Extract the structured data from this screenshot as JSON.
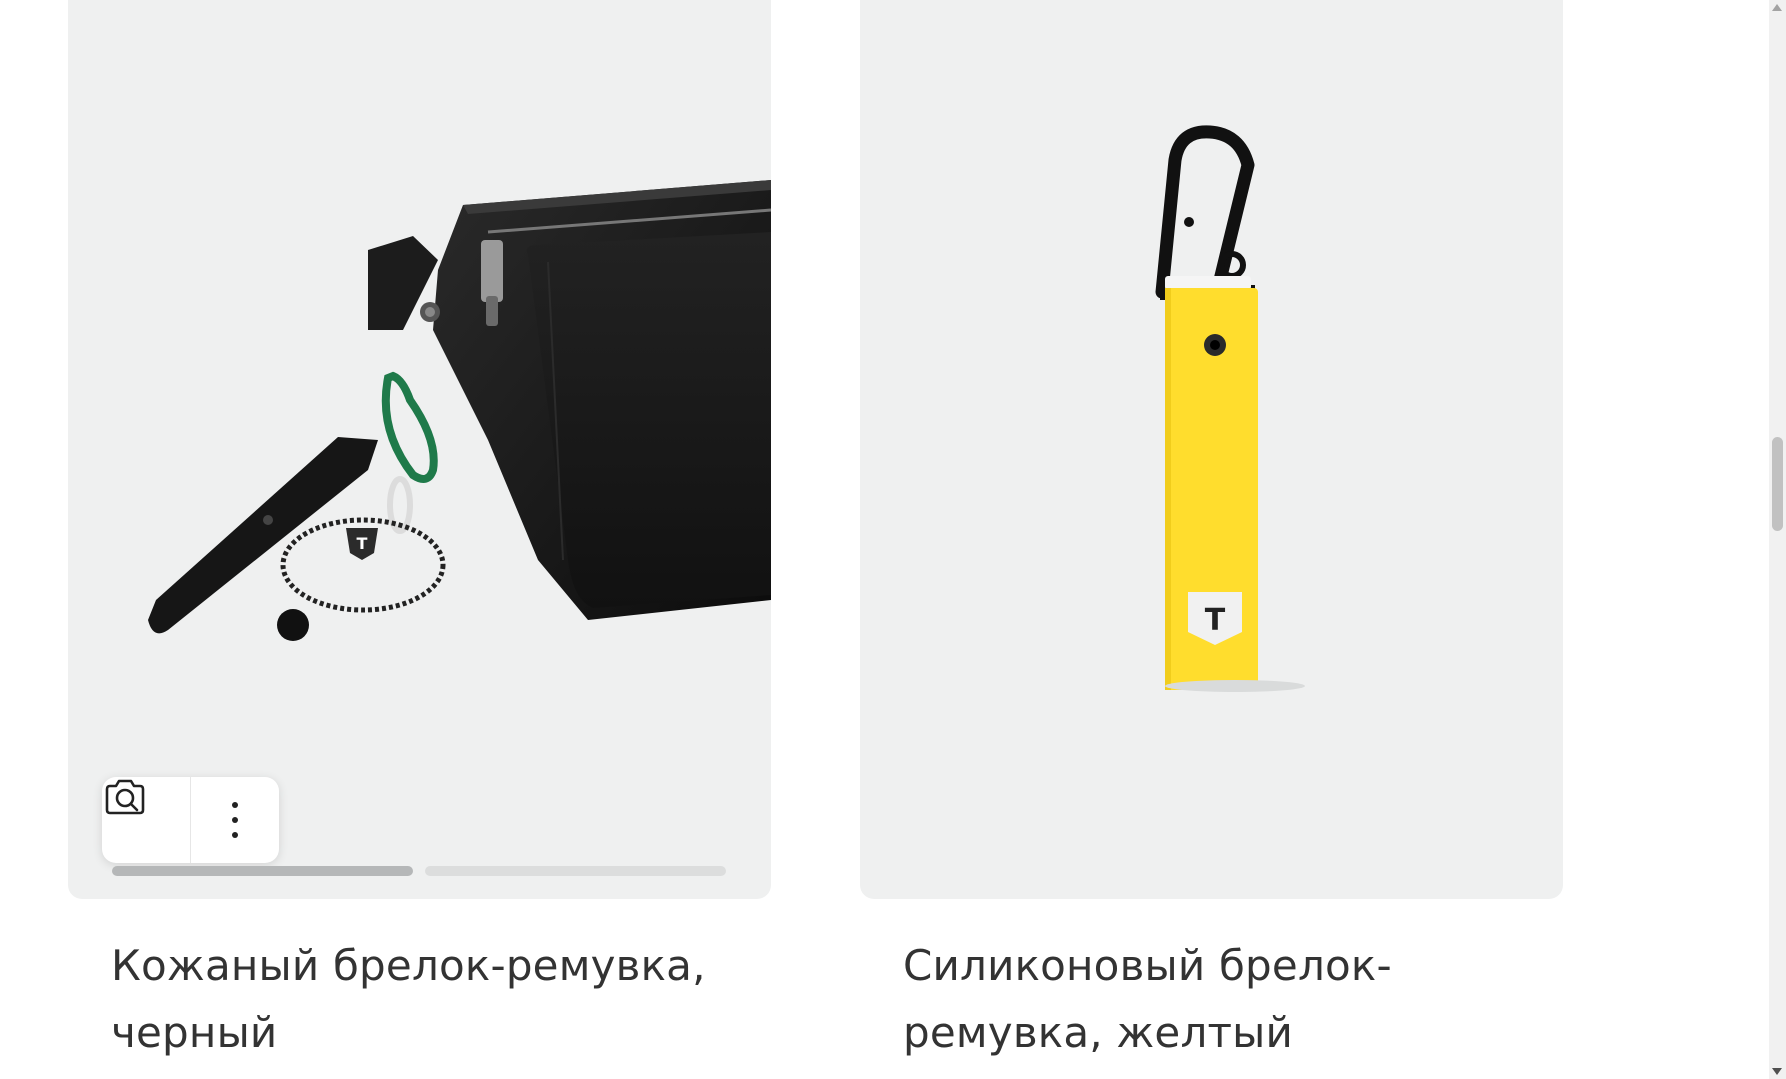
{
  "products": [
    {
      "title": "Кожаный брелок-ремувка, черный",
      "image_alt": "black leather bag with keyring",
      "gallery_progress": 0.5,
      "actions": [
        {
          "icon": "camera-search-icon"
        },
        {
          "icon": "more-vertical-icon"
        }
      ]
    },
    {
      "title": "Силиконовый брелок-ремувка, желтый",
      "image_alt": "yellow silicone keyring with carabiner"
    }
  ],
  "colors": {
    "card_bg": "#eff0f0",
    "title_text": "#333333",
    "accent_yellow": "#ffdd2d"
  }
}
